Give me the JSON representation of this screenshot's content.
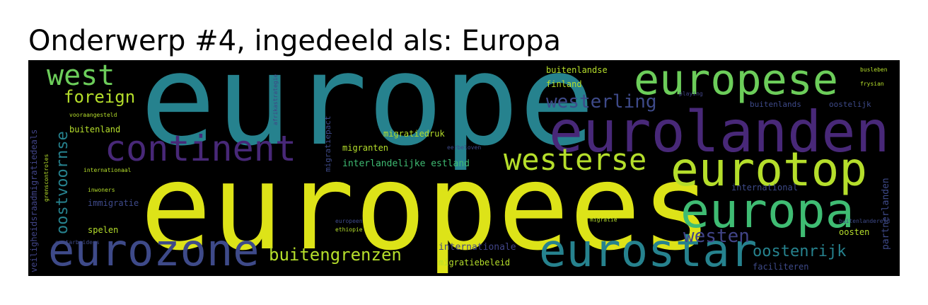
{
  "title": "Onderwerp #4, ingedeeld als: Europa",
  "palette": {
    "yellow": "#dde318",
    "teal": "#26828e",
    "purple": "#482878",
    "lightgreen": "#6ccd5a",
    "green": "#3fbc73",
    "blue": "#3e4a89",
    "indigo": "#414487",
    "olive": "#b5de2b"
  },
  "words": [
    {
      "text": "europe",
      "color": "#26828e"
    },
    {
      "text": "europees",
      "color": "#dde318"
    },
    {
      "text": "eurolanden",
      "color": "#482878"
    },
    {
      "text": "europese",
      "color": "#6ccd5a"
    },
    {
      "text": "eurotop",
      "color": "#b5de2b"
    },
    {
      "text": "europa",
      "color": "#3fbc73"
    },
    {
      "text": "eurozone",
      "color": "#3e4a89"
    },
    {
      "text": "eurostar",
      "color": "#26828e"
    },
    {
      "text": "continent",
      "color": "#482878"
    },
    {
      "text": "westerse",
      "color": "#b5de2b"
    },
    {
      "text": "west",
      "color": "#6ccd5a"
    },
    {
      "text": "foreign",
      "color": "#b5de2b"
    },
    {
      "text": "buitengrenzen",
      "color": "#b5de2b"
    },
    {
      "text": "westerling",
      "color": "#3e4a89"
    },
    {
      "text": "westen",
      "color": "#414487"
    },
    {
      "text": "oostenrijk",
      "color": "#26828e"
    },
    {
      "text": "oostvoornse",
      "color": "#26828e"
    },
    {
      "text": "buitenlandse",
      "color": "#b5de2b"
    },
    {
      "text": "finland",
      "color": "#b5de2b"
    },
    {
      "text": "buitenland",
      "color": "#b5de2b"
    },
    {
      "text": "immigratie",
      "color": "#3e4a89"
    },
    {
      "text": "spelen",
      "color": "#b5de2b"
    },
    {
      "text": "migratiedruk",
      "color": "#b5de2b"
    },
    {
      "text": "migranten",
      "color": "#b5de2b"
    },
    {
      "text": "interlandelijke estland",
      "color": "#3fbc73"
    },
    {
      "text": "internationale",
      "color": "#414487"
    },
    {
      "text": "migratiebeleid",
      "color": "#b5de2b"
    },
    {
      "text": "international",
      "color": "#3e4a89"
    },
    {
      "text": "buitenlands",
      "color": "#3e4a89"
    },
    {
      "text": "oostelijk",
      "color": "#3e4a89"
    },
    {
      "text": "oosten",
      "color": "#b5de2b"
    },
    {
      "text": "faciliteren",
      "color": "#3e4a89"
    },
    {
      "text": "partnerlanden",
      "color": "#3e4a89"
    },
    {
      "text": "veiligheidsraadmigratiedeals",
      "color": "#414487"
    },
    {
      "text": "migratiepact",
      "color": "#3e4a89"
    },
    {
      "text": "internationaal",
      "color": "#b5de2b"
    },
    {
      "text": "grenscontroles",
      "color": "#b5de2b"
    },
    {
      "text": "playing",
      "color": "#414487"
    },
    {
      "text": "afrikastrategie",
      "color": "#414487"
    },
    {
      "text": "vooraangesteld",
      "color": "#b5de2b"
    },
    {
      "text": "ethiopie",
      "color": "#b5de2b"
    },
    {
      "text": "migratie",
      "color": "#b5de2b"
    },
    {
      "text": "buitenlandereld",
      "color": "#3e4a89"
    },
    {
      "text": "busleben",
      "color": "#b5de2b"
    },
    {
      "text": "frysian",
      "color": "#b5de2b"
    },
    {
      "text": "europeen",
      "color": "#3e4a89"
    },
    {
      "text": "eerbeloven",
      "color": "#3e4a89"
    },
    {
      "text": "inwoners",
      "color": "#b5de2b"
    },
    {
      "text": "gastarbeiders",
      "color": "#3e4a89"
    }
  ]
}
